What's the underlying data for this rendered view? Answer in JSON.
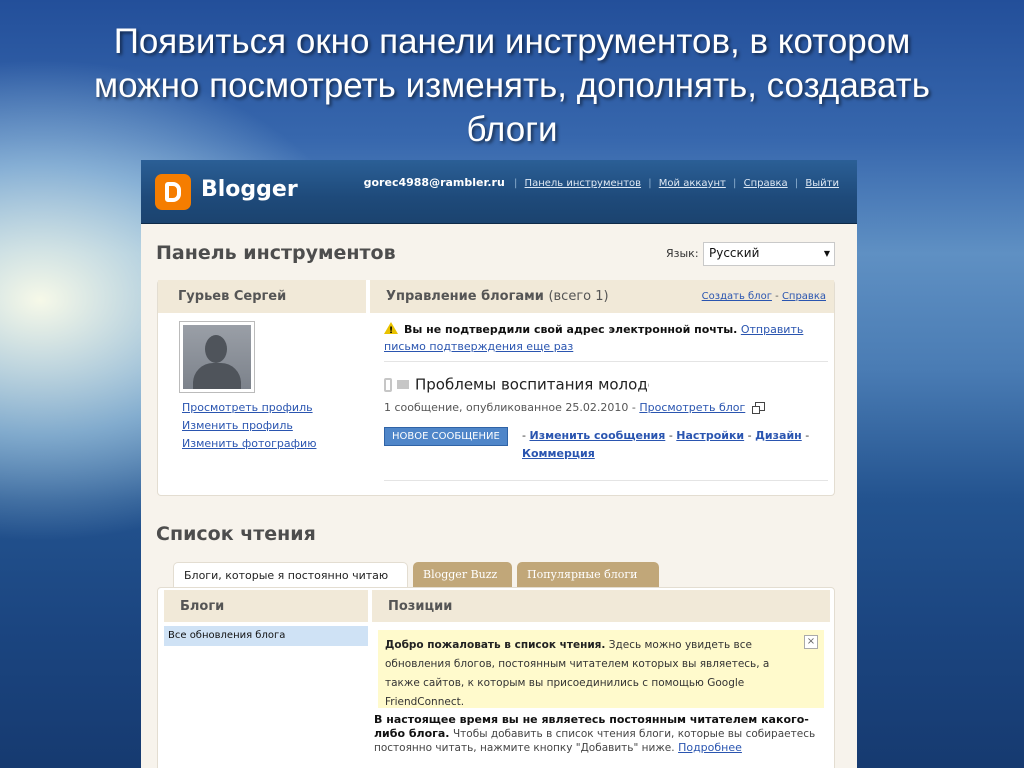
{
  "slide": {
    "title_line1": "Появиться окно панели инструментов, в котором",
    "title_line2": "можно посмотреть изменять, дополнять, создавать",
    "title_line3": "блоги"
  },
  "header": {
    "logo_text": "Blogger",
    "email": "gorec4988@rambler.ru",
    "links": [
      "Панель инструментов",
      "Мой аккаунт",
      "Справка",
      "Выйти"
    ],
    "separator": "|"
  },
  "dashboard": {
    "title": "Панель инструментов",
    "language_label": "Язык:",
    "language_value": "Русский"
  },
  "profile": {
    "name": "Гурьев Сергей",
    "links": [
      "Просмотреть профиль",
      "Изменить профиль",
      "Изменить фотографию"
    ]
  },
  "manage": {
    "title": "Управление блогами",
    "count": "(всего 1)",
    "create_link": "Создать блог",
    "dash": "-",
    "help_link": "Справка",
    "warning_text": "Вы не подтвердили свой адрес электронной почты.",
    "warning_link": "Отправить письмо подтверждения еще раз",
    "blog_title": "Проблемы воспитания молодежи",
    "blog_meta": "1 сообщение, опубликованное 25.02.2010 -",
    "view_blog_link": "Просмотреть блог",
    "new_post_button": "НОВОЕ СООБЩЕНИЕ",
    "action_links": [
      "Изменить сообщения",
      "Настройки",
      "Дизайн",
      "Коммерция"
    ]
  },
  "reading": {
    "title": "Список чтения",
    "tabs": [
      "Блоги, которые я постоянно читаю",
      "Blogger Buzz",
      "Популярные блоги"
    ],
    "col_blogs": "Блоги",
    "col_posts": "Позиции",
    "all_updates": "Все обновления блога",
    "welcome_bold": "Добро пожаловать в список чтения.",
    "welcome_text": "Здесь можно увидеть все обновления блогов, постоянным читателем которых вы являетесь, а также сайтов, к которым вы присоединились с помощью Google FriendConnect.",
    "welcome_close": "×",
    "notice_bold": "В настоящее время вы не являетесь постоянным читателем какого-либо блога.",
    "notice_text": "Чтобы добавить в список чтения блоги, которые вы собираетесь постоянно читать, нажмите кнопку \"Добавить\" ниже.",
    "more_link": "Подробнее"
  }
}
